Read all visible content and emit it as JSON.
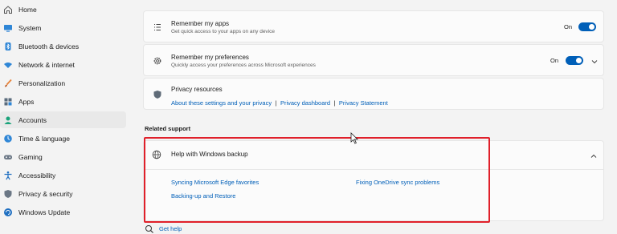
{
  "sidebar": {
    "items": [
      {
        "label": "Home",
        "icon": "home-icon",
        "selected": false
      },
      {
        "label": "System",
        "icon": "system-icon",
        "selected": false
      },
      {
        "label": "Bluetooth & devices",
        "icon": "bluetooth-icon",
        "selected": false
      },
      {
        "label": "Network & internet",
        "icon": "network-icon",
        "selected": false
      },
      {
        "label": "Personalization",
        "icon": "brush-icon",
        "selected": false
      },
      {
        "label": "Apps",
        "icon": "apps-icon",
        "selected": false
      },
      {
        "label": "Accounts",
        "icon": "accounts-icon",
        "selected": true
      },
      {
        "label": "Time & language",
        "icon": "time-language-icon",
        "selected": false
      },
      {
        "label": "Gaming",
        "icon": "gaming-icon",
        "selected": false
      },
      {
        "label": "Accessibility",
        "icon": "accessibility-icon",
        "selected": false
      },
      {
        "label": "Privacy & security",
        "icon": "shield-icon",
        "selected": false
      },
      {
        "label": "Windows Update",
        "icon": "update-icon",
        "selected": false
      }
    ]
  },
  "cards": {
    "apps": {
      "title": "Remember my apps",
      "subtitle": "Get quick access to your apps on any device",
      "state": "On",
      "icon": "list-icon"
    },
    "preferences": {
      "title": "Remember my preferences",
      "subtitle": "Quickly access your preferences across Microsoft experiences",
      "state": "On",
      "icon": "gear-icon"
    },
    "privacy": {
      "title": "Privacy resources",
      "links": [
        "About these settings and your privacy",
        "Privacy dashboard",
        "Privacy Statement"
      ],
      "separator": "|",
      "icon": "shield-icon"
    }
  },
  "related_support": {
    "heading": "Related support",
    "help_title": "Help with Windows backup",
    "links": [
      "Syncing Microsoft Edge favorites",
      "Fixing OneDrive sync problems",
      "Backing-up and Restore"
    ],
    "icon": "globe-icon"
  },
  "get_help": "Get help",
  "colors": {
    "accent": "#005fb8",
    "highlight_box": "#e0202a",
    "background": "#f3f3f3",
    "card": "#fbfbfb"
  }
}
